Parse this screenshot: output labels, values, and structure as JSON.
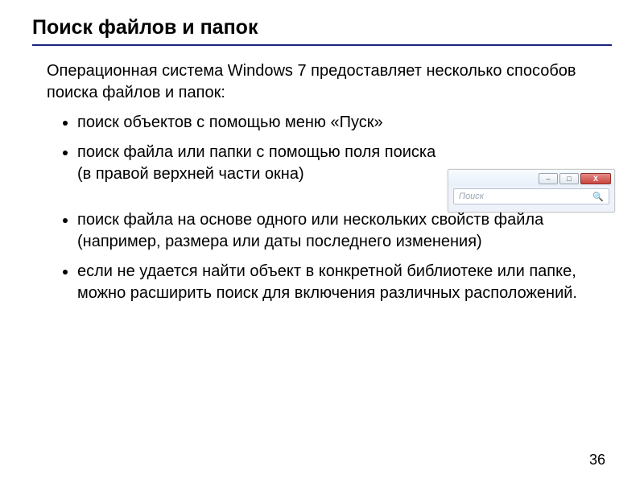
{
  "title": "Поиск файлов и папок",
  "intro": "Операционная система Windows 7 предоставляет несколько способов поиска файлов и папок:",
  "bullets": [
    "поиск объектов с помощью меню «Пуск»",
    "поиск файла или папки с помощью поля поиска (в правой верхней части окна)",
    "поиск файла на основе одного или нескольких свойств файла (например, размера или даты последнего изменения)",
    "если не удается найти объект в конкретной библиотеке или папке, можно расширить поиск для включения различных расположений."
  ],
  "window": {
    "minimize": "–",
    "maximize": "□",
    "close": "X",
    "search_placeholder": "Поиск",
    "search_icon": "🔍"
  },
  "page_number": "36"
}
